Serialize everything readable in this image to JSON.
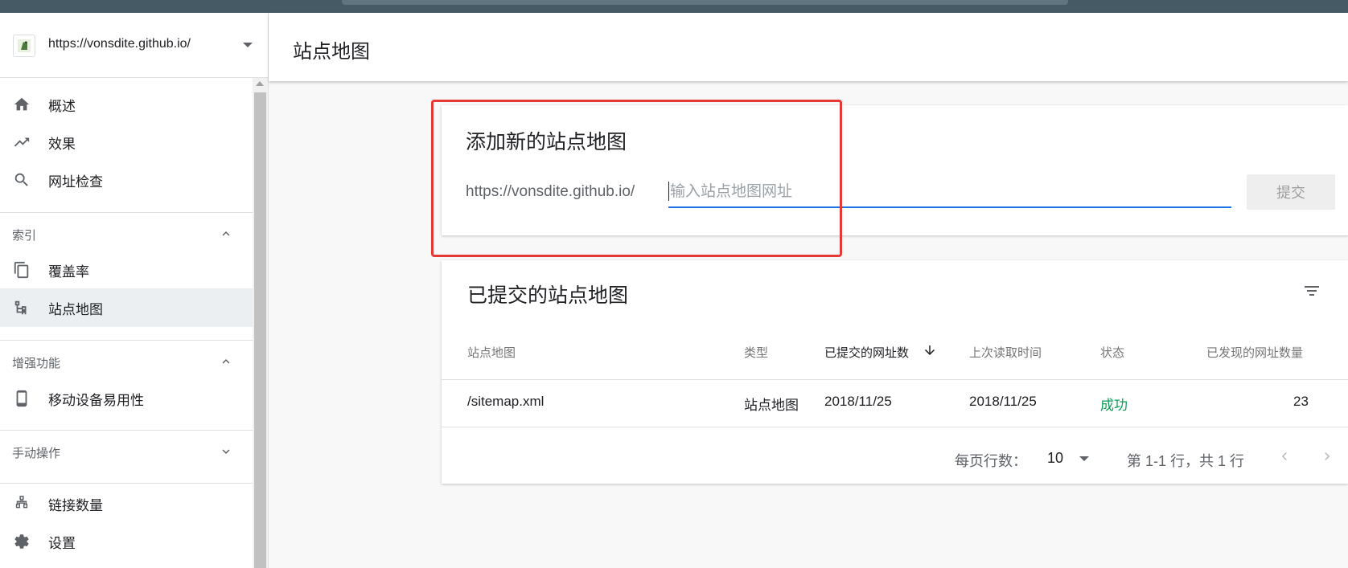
{
  "property": {
    "url": "https://vonsdite.github.io/"
  },
  "sidebar": {
    "top_items": [
      {
        "label": "概述"
      },
      {
        "label": "效果"
      },
      {
        "label": "网址检查"
      }
    ],
    "index_section": {
      "label": "索引"
    },
    "index_items": [
      {
        "label": "覆盖率"
      },
      {
        "label": "站点地图"
      }
    ],
    "enhance_section": {
      "label": "增强功能"
    },
    "enhance_items": [
      {
        "label": "移动设备易用性"
      }
    ],
    "manual_section": {
      "label": "手动操作"
    },
    "bottom_items": [
      {
        "label": "链接数量"
      },
      {
        "label": "设置"
      }
    ]
  },
  "header": {
    "title": "站点地图"
  },
  "add_card": {
    "title": "添加新的站点地图",
    "url_prefix": "https://vonsdite.github.io/",
    "input_placeholder": "输入站点地图网址",
    "input_value": "",
    "submit_label": "提交"
  },
  "submitted_card": {
    "title": "已提交的站点地图",
    "columns": [
      "站点地图",
      "类型",
      "已提交的网址数",
      "上次读取时间",
      "状态",
      "已发现的网址数量"
    ],
    "rows": [
      {
        "sitemap": "/sitemap.xml",
        "type": "站点地图",
        "submitted": "2018/11/25",
        "last_read": "2018/11/25",
        "status": "成功",
        "discovered": "23"
      }
    ],
    "pager": {
      "rows_label": "每页行数：",
      "rows_value": "10",
      "range": "第 1-1 行，共 1 行"
    }
  },
  "colors": {
    "accent": "#1a73e8",
    "success": "#0f9d58",
    "highlight": "#e53935",
    "topbar": "#455a64"
  }
}
